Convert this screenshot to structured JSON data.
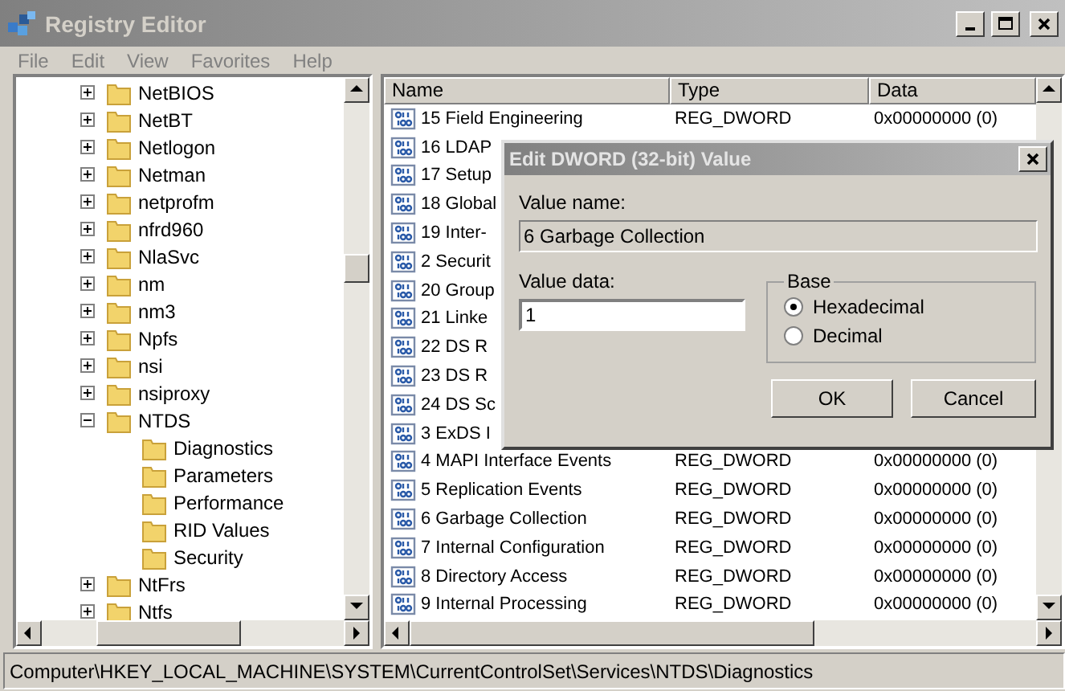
{
  "window": {
    "title": "Registry Editor"
  },
  "menu": [
    "File",
    "Edit",
    "View",
    "Favorites",
    "Help"
  ],
  "tree": {
    "items": [
      {
        "label": "NetBIOS",
        "expanded": false
      },
      {
        "label": "NetBT",
        "expanded": false
      },
      {
        "label": "Netlogon",
        "expanded": false
      },
      {
        "label": "Netman",
        "expanded": false
      },
      {
        "label": "netprofm",
        "expanded": false
      },
      {
        "label": "nfrd960",
        "expanded": false
      },
      {
        "label": "NlaSvc",
        "expanded": false
      },
      {
        "label": "nm",
        "expanded": false
      },
      {
        "label": "nm3",
        "expanded": false
      },
      {
        "label": "Npfs",
        "expanded": false
      },
      {
        "label": "nsi",
        "expanded": false
      },
      {
        "label": "nsiproxy",
        "expanded": false
      },
      {
        "label": "NTDS",
        "expanded": true,
        "children": [
          {
            "label": "Diagnostics"
          },
          {
            "label": "Parameters"
          },
          {
            "label": "Performance"
          },
          {
            "label": "RID Values"
          },
          {
            "label": "Security"
          }
        ]
      },
      {
        "label": "NtFrs",
        "expanded": false
      },
      {
        "label": "Ntfs",
        "expanded": false
      }
    ]
  },
  "list": {
    "columns": [
      "Name",
      "Type",
      "Data"
    ],
    "rows": [
      {
        "name": "15 Field Engineering",
        "type": "REG_DWORD",
        "data": "0x00000000 (0)"
      },
      {
        "name": "16 LDAP"
      },
      {
        "name": "17 Setup"
      },
      {
        "name": "18 Global"
      },
      {
        "name": "19 Inter-"
      },
      {
        "name": "2 Securit"
      },
      {
        "name": "20 Group"
      },
      {
        "name": "21 Linke"
      },
      {
        "name": "22 DS R"
      },
      {
        "name": "23 DS R"
      },
      {
        "name": "24 DS Sc"
      },
      {
        "name": "3 ExDS I"
      },
      {
        "name": "4 MAPI Interface Events",
        "type": "REG_DWORD",
        "data": "0x00000000 (0)"
      },
      {
        "name": "5 Replication Events",
        "type": "REG_DWORD",
        "data": "0x00000000 (0)"
      },
      {
        "name": "6 Garbage Collection",
        "type": "REG_DWORD",
        "data": "0x00000000 (0)"
      },
      {
        "name": "7 Internal Configuration",
        "type": "REG_DWORD",
        "data": "0x00000000 (0)"
      },
      {
        "name": "8 Directory Access",
        "type": "REG_DWORD",
        "data": "0x00000000 (0)"
      },
      {
        "name": "9 Internal Processing",
        "type": "REG_DWORD",
        "data": "0x00000000 (0)"
      }
    ]
  },
  "dialog": {
    "title": "Edit DWORD (32-bit) Value",
    "value_name_label": "Value name:",
    "value_name": "6 Garbage Collection",
    "value_data_label": "Value data:",
    "value_data": "1",
    "base_label": "Base",
    "radios": [
      {
        "label": "Hexadecimal",
        "selected": true
      },
      {
        "label": "Decimal",
        "selected": false
      }
    ],
    "buttons": [
      "OK",
      "Cancel"
    ]
  },
  "status_bar": "Computer\\HKEY_LOCAL_MACHINE\\SYSTEM\\CurrentControlSet\\Services\\NTDS\\Diagnostics"
}
